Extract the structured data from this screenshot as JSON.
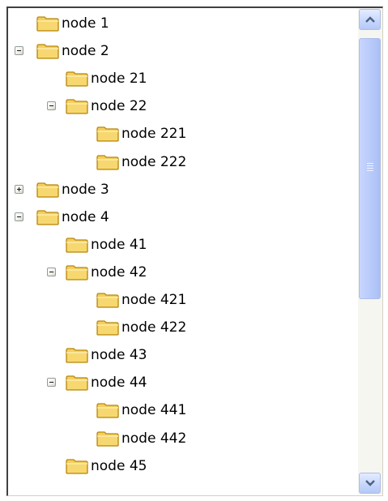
{
  "tree": {
    "rows": [
      {
        "label": "node 1",
        "level": 0,
        "toggle": "none"
      },
      {
        "label": "node 2",
        "level": 0,
        "toggle": "minus"
      },
      {
        "label": "node 21",
        "level": 1,
        "toggle": "none"
      },
      {
        "label": "node 22",
        "level": 1,
        "toggle": "minus"
      },
      {
        "label": "node 221",
        "level": 2,
        "toggle": "none"
      },
      {
        "label": "node 222",
        "level": 2,
        "toggle": "none"
      },
      {
        "label": "node 3",
        "level": 0,
        "toggle": "plus"
      },
      {
        "label": "node 4",
        "level": 0,
        "toggle": "minus"
      },
      {
        "label": "node 41",
        "level": 1,
        "toggle": "none"
      },
      {
        "label": "node 42",
        "level": 1,
        "toggle": "minus"
      },
      {
        "label": "node 421",
        "level": 2,
        "toggle": "none"
      },
      {
        "label": "node 422",
        "level": 2,
        "toggle": "none"
      },
      {
        "label": "node 43",
        "level": 1,
        "toggle": "none"
      },
      {
        "label": "node 44",
        "level": 1,
        "toggle": "minus"
      },
      {
        "label": "node 441",
        "level": 2,
        "toggle": "none"
      },
      {
        "label": "node 442",
        "level": 2,
        "toggle": "none"
      },
      {
        "label": "node 45",
        "level": 1,
        "toggle": "none"
      }
    ]
  },
  "icons": {
    "folder": "folder-icon",
    "expand": "plus-icon",
    "collapse": "minus-icon",
    "scroll_up": "chevron-up-icon",
    "scroll_down": "chevron-down-icon"
  },
  "colors": {
    "folder_fill": "#f4cf5e",
    "folder_edge": "#b8860b",
    "scroll_thumb": "#c0d0fb"
  }
}
